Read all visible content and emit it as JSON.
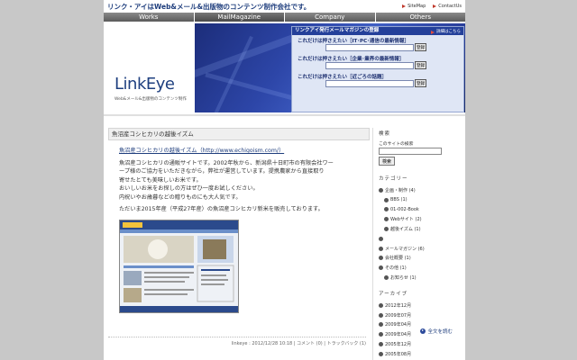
{
  "header": {
    "tagline": "リンク・アイはWeb&メール&出版物のコンテンツ制作会社です。",
    "links": [
      "SiteMap",
      "ContactUs"
    ]
  },
  "nav": [
    "Works",
    "MailMagazine",
    "Company",
    "Others"
  ],
  "brand": {
    "logo": "LinkEye",
    "subtitle": "Web&メール&出版物のコンテンツ制作"
  },
  "mailmag": {
    "title": "リンクアイ発行メールマガジンの登録",
    "detail": "詳細はこちら",
    "rows": [
      {
        "label": "これだけは押さえたい［IT･PC･通信の最新情報］",
        "button": "登録"
      },
      {
        "label": "これだけは押さえたい［企業･業界の最新情報］",
        "button": "登録"
      },
      {
        "label": "これだけは押さえたい［近ごろの話題］",
        "button": "登録"
      }
    ]
  },
  "entry": {
    "title": "魚沼産コシヒカリの越後イズム",
    "link_text": "魚沼産コシヒカリの越後イズム（http://www.echigoism.com/）",
    "para1": [
      "魚沼産コシヒカリの通販サイトです。2002年秋から、新潟県十日町市の有限会社ワー",
      "ープ様のご協力をいただきながら，弊社が運営しています。提携農家から直接取り",
      "寄せたとても美味しいお米です。",
      "おいしいお米をお探しの方はぜひ一度お試しください。",
      "内祝いやお歳暮などの贈りものにも大人気です。"
    ],
    "para2": "ただいま2015年産（平成27年産）の魚沼産コシヒカリ新米を販売しております。",
    "readmore": "全文を読む",
    "meta": "linkeye : 2012/12/28 10:18 | コメント (0) | トラックバック (1)"
  },
  "sidebar": {
    "search_heading": "検索",
    "search_label": "このサイトの検索",
    "search_button": "検索",
    "category_heading": "カテゴリー",
    "categories": [
      {
        "label": "企画・制作 (4)",
        "sub": false
      },
      {
        "label": "BBS (1)",
        "sub": true
      },
      {
        "label": "01-002-Book",
        "sub": true
      },
      {
        "label": "Webサイト (2)",
        "sub": true
      },
      {
        "label": "越後イズム (1)",
        "sub": true
      },
      {
        "label": "",
        "sub": false,
        "gap": true
      },
      {
        "label": "メールマガジン (6)",
        "sub": false
      },
      {
        "label": "会社概要 (1)",
        "sub": false
      },
      {
        "label": "その他 (1)",
        "sub": false
      },
      {
        "label": "お知らせ (1)",
        "sub": true
      }
    ],
    "archive_heading": "アーカイブ",
    "archives": [
      "2012年12月",
      "2009年07月",
      "2009年04月",
      "2009年04月",
      "2005年12月",
      "2005年08月"
    ]
  },
  "colors": {
    "brand": "#1e3f7f",
    "banner": "#2d46a8"
  }
}
